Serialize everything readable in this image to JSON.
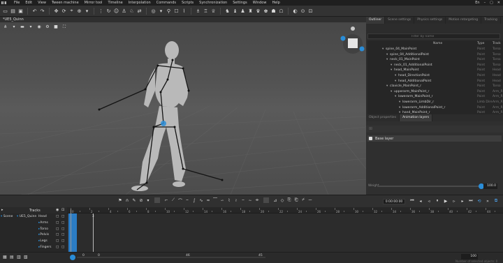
{
  "menu": [
    "File",
    "Edit",
    "View",
    "Tween machine",
    "Mirror tool",
    "Timeline",
    "Interpolation",
    "Commands",
    "Scripts",
    "Synchronization",
    "Settings",
    "Window",
    "Help"
  ],
  "menu_right": {
    "lang": "En"
  },
  "viewport": {
    "tab_label": "*UE5_Quinn"
  },
  "outliner": {
    "tabs": [
      "Outliner",
      "Scene settings",
      "Physics settings",
      "Motion retargeting",
      "Tracking"
    ],
    "filter_placeholder": "Filter by name",
    "columns": {
      "name": "Name",
      "type": "Type",
      "track": "Track"
    },
    "rows": [
      {
        "name": "spine_04_MainPoint",
        "type": "Point",
        "track": "Torso",
        "indent": 1
      },
      {
        "name": "spine_04_AdditionalPoint",
        "type": "Point",
        "track": "Torso",
        "indent": 2
      },
      {
        "name": "neck_01_MainPoint",
        "type": "Point",
        "track": "Torso",
        "indent": 2
      },
      {
        "name": "neck_01_AdditionalPoint",
        "type": "Point",
        "track": "Torso",
        "indent": 3
      },
      {
        "name": "head_MainPoint",
        "type": "Point",
        "track": "Head",
        "indent": 3
      },
      {
        "name": "head_DirectionPoint",
        "type": "Point",
        "track": "Head",
        "indent": 4
      },
      {
        "name": "head_AdditionalPoint",
        "type": "Point",
        "track": "Head",
        "indent": 4
      },
      {
        "name": "clavicle_MainPoint_r",
        "type": "Point",
        "track": "Torso",
        "indent": 2
      },
      {
        "name": "upperarm_MainPoint_r",
        "type": "Point",
        "track": "Arm_R",
        "indent": 3
      },
      {
        "name": "lowerarm_MainPoint_r",
        "type": "Point",
        "track": "Arm_R",
        "indent": 4
      },
      {
        "name": "lowerarm_LimbDir_r",
        "type": "Limb Dire",
        "track": "Arm_R",
        "indent": 5
      },
      {
        "name": "lowerarm_AdditionalPoint_r",
        "type": "Point",
        "track": "Arm_R",
        "indent": 5
      },
      {
        "name": "hand_MainPoint_r",
        "type": "Point",
        "track": "Arm_R",
        "indent": 5
      }
    ],
    "bottom_tabs": [
      "Object properties",
      "Animation layers"
    ]
  },
  "layers": {
    "base_layer": "Base layer",
    "weight_label": "Weight",
    "weight_value": "100.0"
  },
  "timeline": {
    "current_time": "0:00:00:00",
    "tracks_label": "Tracks",
    "scene_label": "Scene",
    "character_label": "UE5_Quinn",
    "tracks": [
      "Head",
      "Arms",
      "Torso",
      "Pelvis",
      "Legs",
      "Fingers"
    ],
    "ruler_ticks": [
      "0",
      "2",
      "4",
      "6",
      "8",
      "10",
      "12",
      "14",
      "16",
      "18",
      "20",
      "22",
      "24",
      "26",
      "28",
      "30",
      "32",
      "34",
      "36",
      "38",
      "40",
      "42",
      "44"
    ],
    "end_frame": "3"
  },
  "status": {
    "start": "0",
    "range_start": "0",
    "range_mid": "46",
    "range_end": "45",
    "zoom": "100",
    "note": "Number of selected objects: 0"
  },
  "colors": {
    "accent": "#2a8dd8",
    "key_range": "#2b7cc4"
  }
}
